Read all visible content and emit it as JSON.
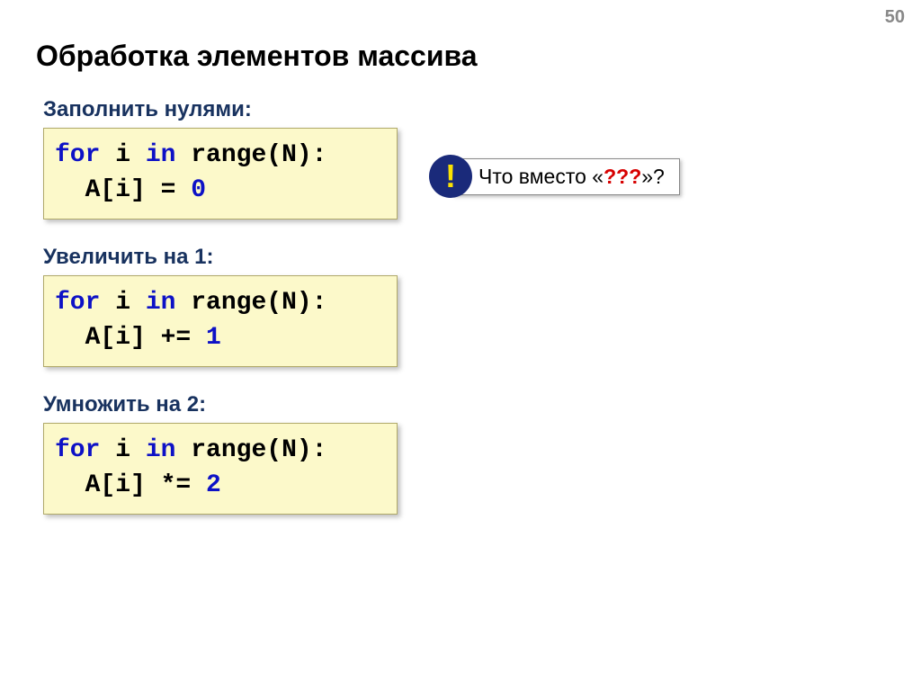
{
  "pageNumber": "50",
  "title": "Обработка элементов массива",
  "sections": {
    "fillZeros": {
      "label": "Заполнить нулями:",
      "line1": {
        "t1": "for",
        "t2": " i ",
        "t3": "in",
        "t4": " range(N):"
      },
      "line2": {
        "t1": "  A[i] = ",
        "t2": "0"
      }
    },
    "incOne": {
      "label": "Увеличить на 1:",
      "line1": {
        "t1": "for",
        "t2": " i ",
        "t3": "in",
        "t4": " range(N):"
      },
      "line2": {
        "t1": "  A[i] += ",
        "t2": "1"
      }
    },
    "mulTwo": {
      "label": "Умножить на 2:",
      "line1": {
        "t1": "for",
        "t2": " i ",
        "t3": "in",
        "t4": " range(N):"
      },
      "line2": {
        "t1": "  A[i] *= ",
        "t2": "2"
      }
    }
  },
  "callout": {
    "mark": "!",
    "textBefore": "Что вместо «",
    "accent": "???",
    "textAfter": "»?"
  }
}
